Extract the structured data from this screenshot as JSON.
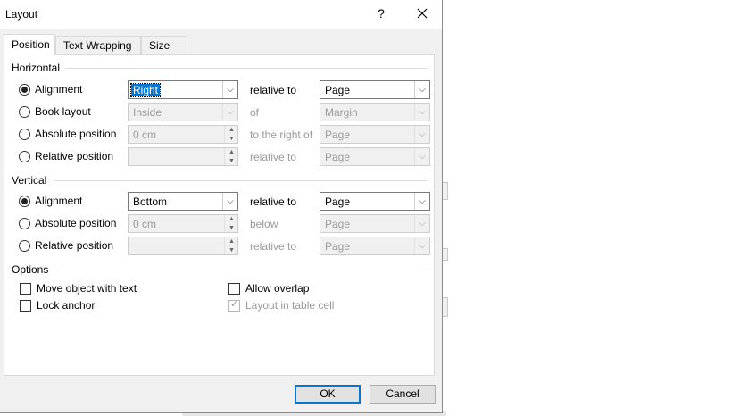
{
  "window": {
    "title": "Layout",
    "help": "?",
    "close": "✕"
  },
  "tabs": [
    {
      "label": "Position",
      "active": true
    },
    {
      "label": "Text Wrapping",
      "active": false
    },
    {
      "label": "Size",
      "active": false
    }
  ],
  "horizontal": {
    "group_label": "Horizontal",
    "rows": [
      {
        "label": "Alignment",
        "checked": true,
        "value": "Right",
        "mid": "relative to",
        "target": "Page"
      },
      {
        "label": "Book layout",
        "checked": false,
        "value": "Inside",
        "mid": "of",
        "target": "Margin"
      },
      {
        "label": "Absolute position",
        "checked": false,
        "value": "0 cm",
        "mid": "to the right of",
        "target": "Page"
      },
      {
        "label": "Relative position",
        "checked": false,
        "value": "",
        "mid": "relative to",
        "target": "Page"
      }
    ]
  },
  "vertical": {
    "group_label": "Vertical",
    "rows": [
      {
        "label": "Alignment",
        "checked": true,
        "value": "Bottom",
        "mid": "relative to",
        "target": "Page"
      },
      {
        "label": "Absolute position",
        "checked": false,
        "value": "0 cm",
        "mid": "below",
        "target": "Page"
      },
      {
        "label": "Relative position",
        "checked": false,
        "value": "",
        "mid": "relative to",
        "target": "Page"
      }
    ]
  },
  "options": {
    "group_label": "Options",
    "move_object": {
      "label": "Move object with text",
      "checked": false
    },
    "lock_anchor": {
      "label": "Lock anchor",
      "checked": false
    },
    "allow_overlap": {
      "label": "Allow overlap",
      "checked": false
    },
    "layout_in_table": {
      "label": "Layout in table cell",
      "checked": true,
      "disabled": true
    }
  },
  "buttons": {
    "ok": "OK",
    "cancel": "Cancel"
  },
  "icons": {
    "dropdown": "chevron-down-icon",
    "spin_up": "▲",
    "spin_down": "▼"
  }
}
